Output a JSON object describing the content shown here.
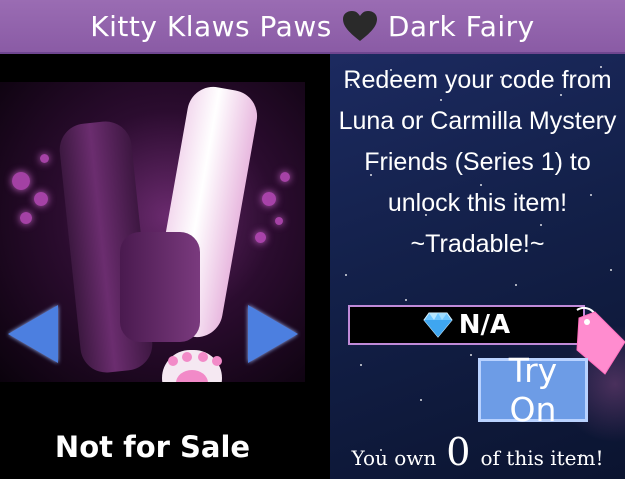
{
  "header": {
    "title_left": "Kitty Klaws Paws",
    "title_right": "Dark Fairy"
  },
  "item": {
    "description": "Redeem your code from Luna or Carmilla Mystery Friends (Series 1) to unlock this item! ~Tradable!~",
    "price": "N/A",
    "sale_status": "Not for Sale",
    "owned_prefix": "You own",
    "owned_count": "0",
    "owned_suffix": "of this item!"
  },
  "buttons": {
    "try_on": "Try On"
  },
  "icons": {
    "title_heart": "heart-icon",
    "price_gem": "diamond-icon",
    "tag": "price-tag-icon",
    "prev": "arrow-left-icon",
    "next": "arrow-right-icon"
  },
  "colors": {
    "title_bar": "#9a6cb3",
    "try_on_button": "#6d9ce6",
    "arrow": "#4c7fe0",
    "price_border": "#c08ad8",
    "tag": "#ff8ccf"
  }
}
